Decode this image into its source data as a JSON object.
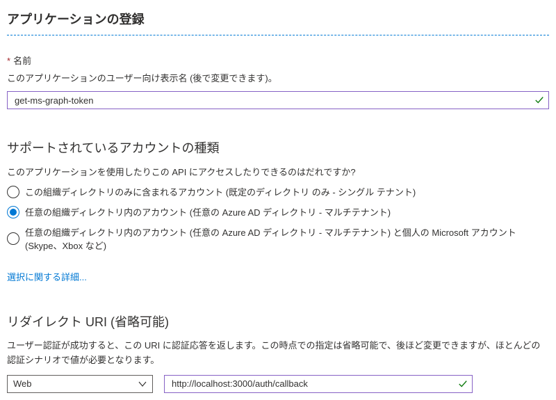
{
  "page_title": "アプリケーションの登録",
  "name_section": {
    "label": "名前",
    "description": "このアプリケーションのユーザー向け表示名 (後で変更できます)。",
    "value": "get-ms-graph-token"
  },
  "account_types": {
    "title": "サポートされているアカウントの種類",
    "question": "このアプリケーションを使用したりこの API にアクセスしたりできるのはだれですか?",
    "options": [
      {
        "label": "この組織ディレクトリのみに含まれるアカウント (既定のディレクトリ のみ - シングル テナント)",
        "selected": false
      },
      {
        "label": "任意の組織ディレクトリ内のアカウント (任意の Azure AD ディレクトリ - マルチテナント)",
        "selected": true
      },
      {
        "label": "任意の組織ディレクトリ内のアカウント (任意の Azure AD ディレクトリ - マルチテナント) と個人の Microsoft アカウント (Skype、Xbox など)",
        "selected": false
      }
    ],
    "help_link": "選択に関する詳細..."
  },
  "redirect_uri": {
    "title": "リダイレクト URI (省略可能)",
    "description": "ユーザー認証が成功すると、この URI に認証応答を返します。この時点での指定は省略可能で、後ほど変更できますが、ほとんどの認証シナリオで値が必要となります。",
    "platform_selected": "Web",
    "value": "http://localhost:3000/auth/callback"
  },
  "colors": {
    "accent": "#0078d4",
    "input_border": "#8661c5",
    "success": "#107c10",
    "required": "#a4262c"
  }
}
